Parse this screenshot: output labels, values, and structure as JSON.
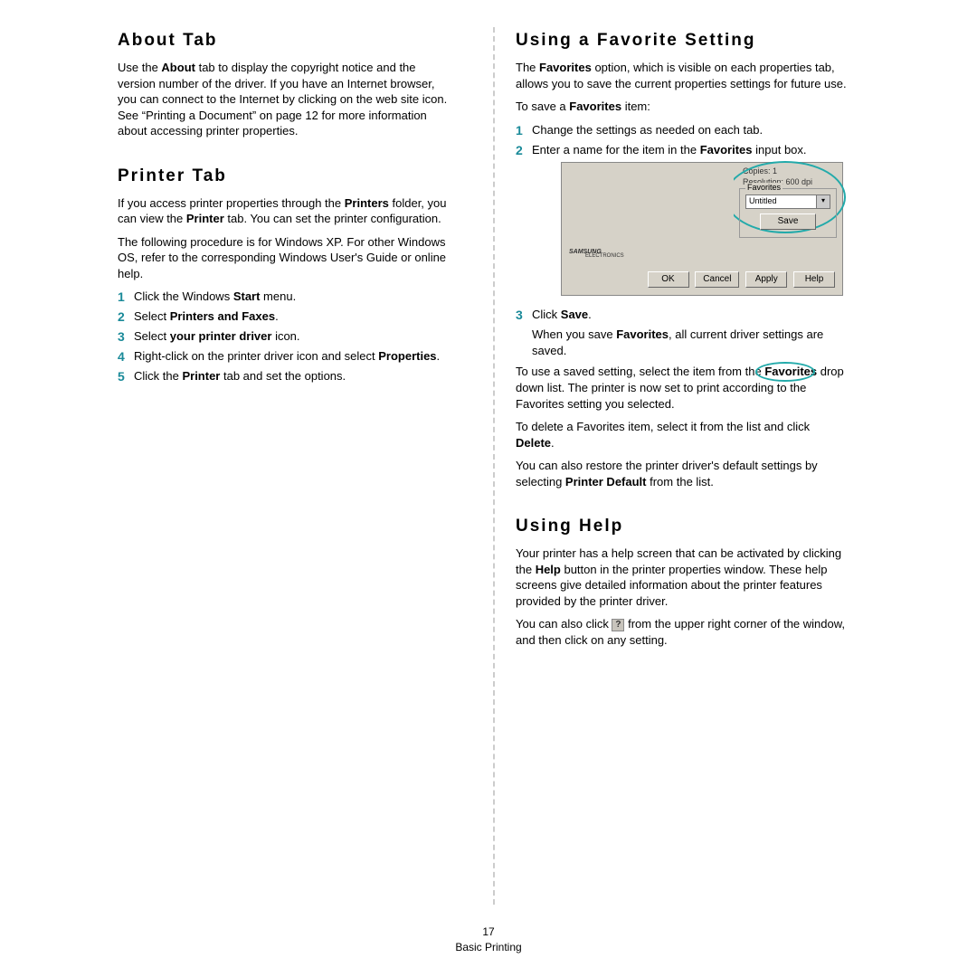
{
  "left": {
    "about": {
      "title": "About Tab",
      "p1a": "Use the ",
      "p1b": "About",
      "p1c": " tab to display the copyright notice and the version number of the driver. If you have an Internet browser, you can connect to the Internet by clicking on the web site icon. See “Printing a Document” on page 12 for more information about accessing printer properties."
    },
    "printer": {
      "title": "Printer Tab",
      "p1a": "If you access printer properties through the ",
      "p1b": "Printers",
      "p1c": " folder, you can view the ",
      "p1d": "Printer",
      "p1e": " tab. You can set the printer configuration.",
      "p2": "The following procedure is for Windows XP. For other Windows OS, refer to the corresponding Windows User's Guide or online help.",
      "s1a": "Click the Windows ",
      "s1b": "Start",
      "s1c": " menu.",
      "s2a": "Select ",
      "s2b": "Printers and Faxes",
      "s2c": ".",
      "s3a": "Select ",
      "s3b": "your printer driver",
      "s3c": " icon.",
      "s4a": "Right-click on the printer driver icon and select ",
      "s4b": "Properties",
      "s4c": ".",
      "s5a": "Click the ",
      "s5b": "Printer",
      "s5c": " tab and set the options."
    }
  },
  "right": {
    "fav": {
      "title": "Using a Favorite Setting",
      "p1a": "The ",
      "p1b": "Favorites",
      "p1c": " option, which is visible on each properties tab, allows you to save the current properties settings for future use.",
      "p2a": "To save a ",
      "p2b": "Favorites",
      "p2c": " item:",
      "s1": "Change the settings as needed on each tab.",
      "s2a": "Enter a name for the item in the ",
      "s2b": "Favorites",
      "s2c": " input box.",
      "s3a": "Click ",
      "s3b": "Save",
      "s3c": ".",
      "s3suba": "When you save ",
      "s3subb": "Favorites",
      "s3subc": ", all current driver settings are saved.",
      "p3a": "To use a saved setting, select the item from the ",
      "p3b": "Favorites",
      "p3c": " drop down list. The printer is now set to print according to the Favorites setting you selected.",
      "p4a": "To delete a Favorites item, select it from the list and click ",
      "p4b": "Delete",
      "p4c": ".",
      "p5a": "You can also restore the printer driver's default settings by selecting ",
      "p5b": "Printer Default",
      "p5c": " from the list."
    },
    "help": {
      "title": "Using Help",
      "p1a": "Your printer has a help screen that can be activated by clicking the ",
      "p1b": "Help",
      "p1c": " button in the printer properties window. These help screens give detailed information about the printer features provided by the printer driver.",
      "p2a": "You can also click ",
      "p2b": " from the upper right corner of the window, and then click on any setting."
    }
  },
  "shot": {
    "copies": "Copies: 1",
    "resolution": "Resolution: 600 dpi",
    "favLabel": "Favorites",
    "favValue": "Untitled",
    "save": "Save",
    "ok": "OK",
    "cancel": "Cancel",
    "apply": "Apply",
    "help": "Help",
    "logo": "SAMSUNG",
    "logoSub": "ELECTRONICS"
  },
  "footer": {
    "page": "17",
    "chapter": "Basic Printing"
  }
}
